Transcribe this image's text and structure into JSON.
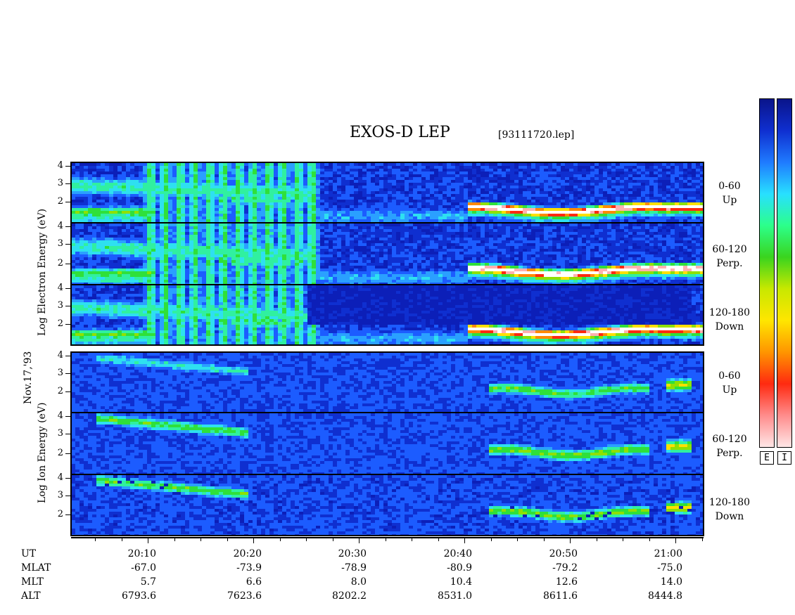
{
  "title": "EXOS-D LEP",
  "filename": "[93111720.lep]",
  "date_label": "Nov.17,'93",
  "electron_ylabel": "Log  Electron  Energy (eV)",
  "ion_ylabel": "Log  Ion  Energy (eV)",
  "colorbar_labels": [
    "E",
    "I"
  ],
  "colorbar_colors": [
    "#0a148a",
    "#0f2fd0",
    "#1f7bff",
    "#28e0ff",
    "#2cff8a",
    "#3ad41e",
    "#c8e800",
    "#ffe600",
    "#ff9500",
    "#ff2a10",
    "#ff8c8c",
    "#ffe6e6"
  ],
  "chart_data": {
    "type": "heatmap",
    "time_ticks": [
      "20:10",
      "20:20",
      "20:30",
      "20:40",
      "20:50",
      "21:00"
    ],
    "ytick_labels": [
      "4",
      "3",
      "2"
    ],
    "panels": [
      {
        "species": "Electron",
        "pitch_angle": "0-60",
        "direction": "Up"
      },
      {
        "species": "Electron",
        "pitch_angle": "60-120",
        "direction": "Perp."
      },
      {
        "species": "Electron",
        "pitch_angle": "120-180",
        "direction": "Down"
      },
      {
        "species": "Ion",
        "pitch_angle": "0-60",
        "direction": "Up"
      },
      {
        "species": "Ion",
        "pitch_angle": "60-120",
        "direction": "Perp."
      },
      {
        "species": "Ion",
        "pitch_angle": "120-180",
        "direction": "Down"
      }
    ],
    "ephemeris": {
      "rows": [
        "UT",
        "MLAT",
        "MLT",
        "ALT"
      ],
      "UT": [
        "20:10",
        "20:20",
        "20:30",
        "20:40",
        "20:50",
        "21:00"
      ],
      "MLAT": [
        "-67.0",
        "-73.9",
        "-78.9",
        "-80.9",
        "-79.2",
        "-75.0"
      ],
      "MLT": [
        "5.7",
        "6.6",
        "8.0",
        "10.4",
        "12.6",
        "14.0"
      ],
      "ALT": [
        "6793.6",
        "7623.6",
        "8202.2",
        "8531.0",
        "8611.6",
        "8444.8"
      ]
    }
  }
}
